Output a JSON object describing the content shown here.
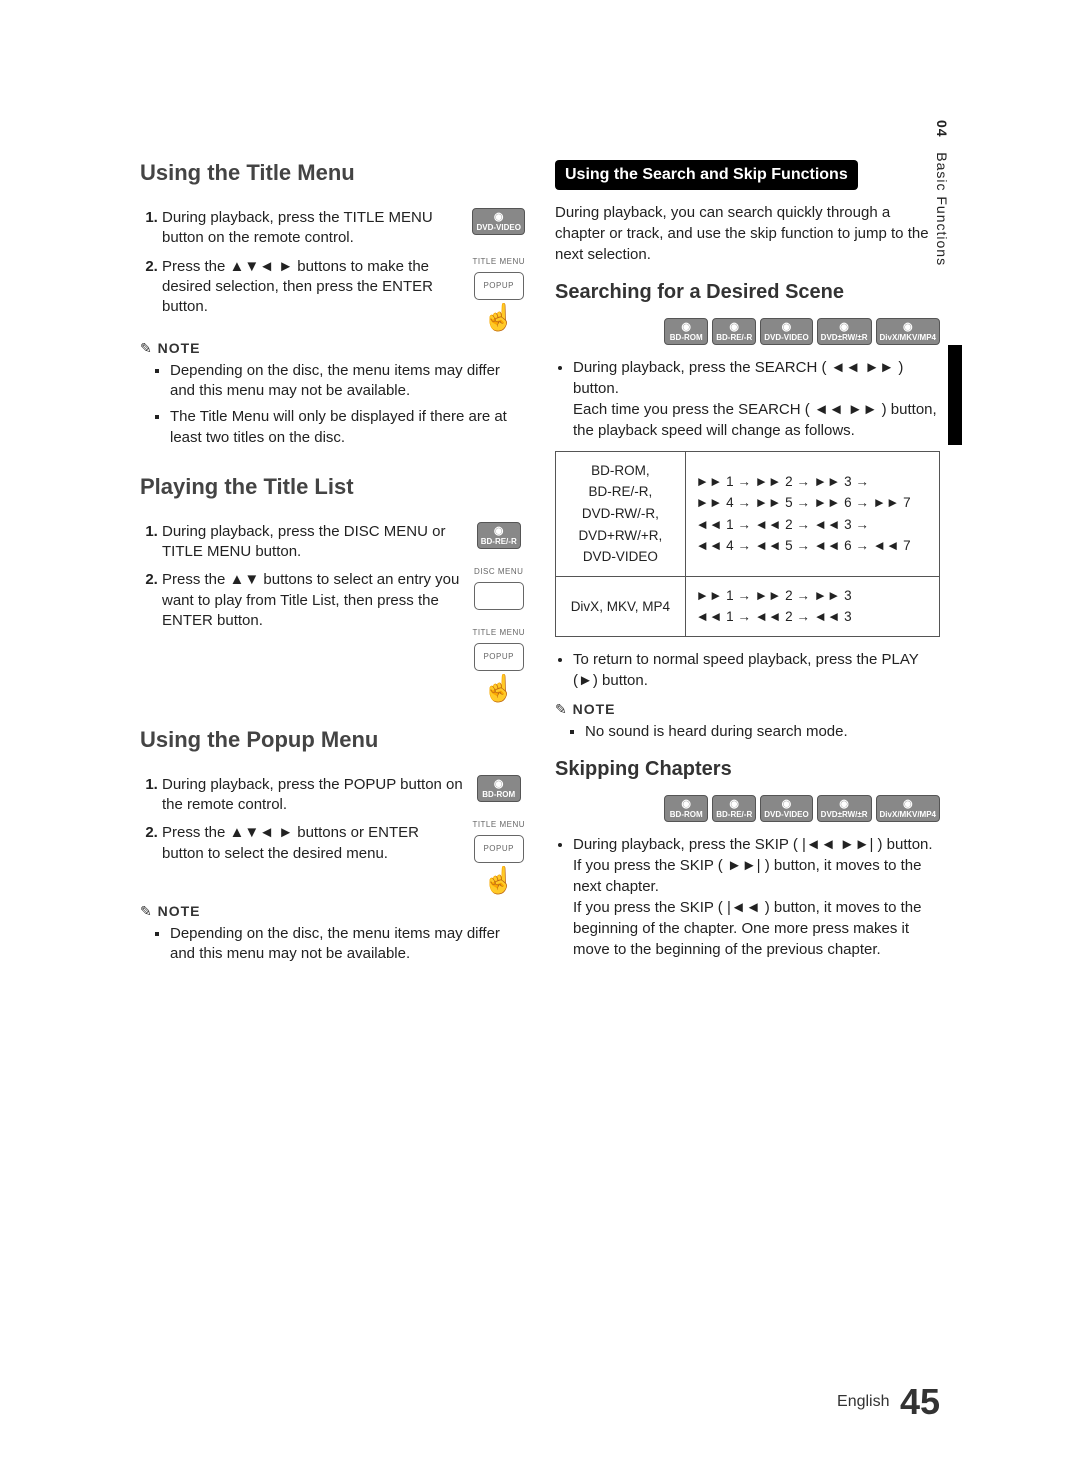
{
  "sidebar": {
    "chapter": "04",
    "title": "Basic Functions"
  },
  "left": {
    "s1": {
      "heading": "Using the Title Menu",
      "disc_badge": "DVD-VIDEO",
      "remote_label": "TITLE MENU",
      "remote_sublabel": "POPUP",
      "step1": "During playback, press the TITLE MENU button on the remote control.",
      "step2": "Press the ▲▼◄ ► buttons to make the desired selection, then press the ENTER button.",
      "note_label": "NOTE",
      "note1": "Depending on the disc, the menu items may differ and this menu may not be available.",
      "note2": "The Title Menu will only be displayed if there are at least two titles on the disc."
    },
    "s2": {
      "heading": "Playing the Title List",
      "disc_badge": "BD-RE/-R",
      "remote_label1": "DISC MENU",
      "remote_label2": "TITLE MENU",
      "remote_sublabel": "POPUP",
      "step1": "During playback, press the DISC MENU or TITLE MENU button.",
      "step2": "Press the ▲▼ buttons to select an entry you want to play from Title List, then press the ENTER button."
    },
    "s3": {
      "heading": "Using the Popup Menu",
      "disc_badge": "BD-ROM",
      "remote_label": "TITLE MENU",
      "remote_sublabel": "POPUP",
      "step1": "During playback, press the POPUP button on the remote control.",
      "step2": "Press the ▲▼◄ ► buttons or ENTER button to select the desired menu.",
      "note_label": "NOTE",
      "note1": "Depending on the disc, the menu items may differ and this menu may not be available."
    }
  },
  "right": {
    "bar": "Using the Search and Skip Functions",
    "intro": "During playback, you can search quickly through a chapter or track, and use the skip function to jump to the next selection.",
    "search": {
      "heading": "Searching for a Desired Scene",
      "discs": [
        "BD-ROM",
        "BD-RE/-R",
        "DVD-VIDEO",
        "DVD±RW/±R",
        "DivX/MKV/MP4"
      ],
      "bullet1": "During playback, press the SEARCH ( ◄◄ ►► ) button.\nEach time you press the SEARCH ( ◄◄ ►► ) button, the playback speed will change as follows.",
      "table_row1_left": "BD-ROM,\nBD-RE/-R,\nDVD-RW/-R,\nDVD+RW/+R,\nDVD-VIDEO",
      "table_row1_right": "►► 1 → ►► 2 → ►► 3 →\n►► 4 → ►► 5 → ►► 6 → ►► 7\n◄◄ 1 → ◄◄ 2 → ◄◄ 3 →\n◄◄ 4 → ◄◄ 5 → ◄◄ 6 → ◄◄ 7",
      "table_row2_left": "DivX, MKV, MP4",
      "table_row2_right": "►► 1 → ►► 2 → ►► 3\n◄◄ 1 → ◄◄ 2 → ◄◄ 3",
      "bullet2": "To return to normal speed playback, press the PLAY (►) button.",
      "note_label": "NOTE",
      "note1": "No sound is heard during search mode."
    },
    "skip": {
      "heading": "Skipping Chapters",
      "discs": [
        "BD-ROM",
        "BD-RE/-R",
        "DVD-VIDEO",
        "DVD±RW/±R",
        "DivX/MKV/MP4"
      ],
      "bullet1": "During playback, press the SKIP ( |◄◄ ►►| ) button.\nIf you press the SKIP ( ►►| ) button, it moves to the next chapter.\nIf you press the SKIP ( |◄◄ ) button, it moves to the beginning of the chapter. One more press makes it move to the beginning of the previous chapter."
    }
  },
  "footer": {
    "lang": "English",
    "page": "45"
  }
}
